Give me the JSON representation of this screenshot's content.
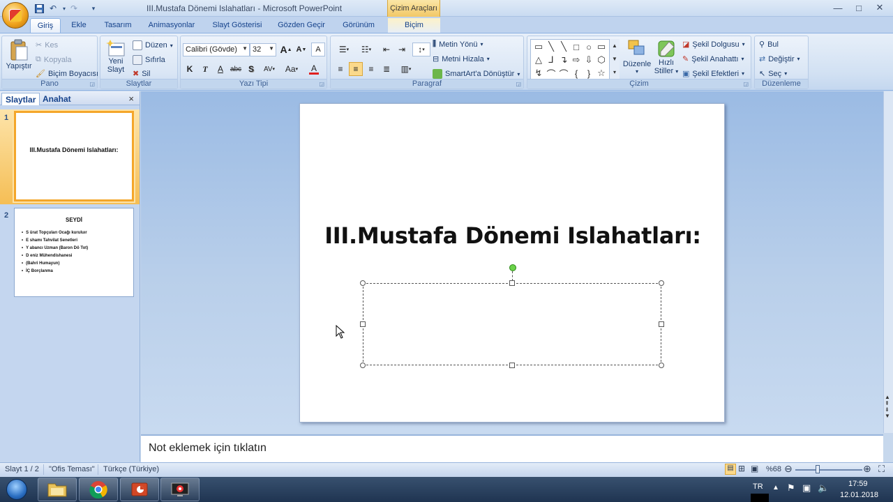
{
  "window": {
    "title": "III.Mustafa Dönemi Islahatları - Microsoft PowerPoint",
    "context_tab_group": "Çizim Araçları",
    "controls": {
      "minimize": "—",
      "maximize": "□",
      "close": "✕"
    }
  },
  "quick_access": {
    "save": "save-icon",
    "undo": "undo-icon",
    "redo": "redo-icon",
    "customize": "▾"
  },
  "tabs": [
    {
      "label": "Giriş",
      "active": true
    },
    {
      "label": "Ekle"
    },
    {
      "label": "Tasarım"
    },
    {
      "label": "Animasyonlar"
    },
    {
      "label": "Slayt Gösterisi"
    },
    {
      "label": "Gözden Geçir"
    },
    {
      "label": "Görünüm"
    },
    {
      "label": "Biçim",
      "context": true
    }
  ],
  "ribbon": {
    "pano": {
      "label": "Pano",
      "paste": "Yapıştır",
      "cut": "Kes",
      "copy": "Kopyala",
      "format_painter": "Biçim Boyacısı"
    },
    "slaytlar": {
      "label": "Slaytlar",
      "new_slide_line1": "Yeni",
      "new_slide_line2": "Slayt",
      "layout": "Düzen",
      "reset": "Sıfırla",
      "delete": "Sil"
    },
    "yazi_tipi": {
      "label": "Yazı Tipi",
      "font_name": "Calibri (Gövde)",
      "font_size": "32",
      "grow": "A",
      "shrink": "A",
      "clear": "A",
      "bold": "K",
      "italic": "T",
      "underline": "A",
      "strike": "abc",
      "shadow": "S",
      "spacing": "AV",
      "case": "Aa",
      "color": "A"
    },
    "paragraf": {
      "label": "Paragraf",
      "text_direction": "Metin Yönü",
      "align_text": "Metni Hizala",
      "smartart": "SmartArt'a Dönüştür"
    },
    "cizim": {
      "label": "Çizim",
      "arrange": "Düzenle",
      "quick_styles_line1": "Hızlı",
      "quick_styles_line2": "Stiller",
      "shape_fill": "Şekil Dolgusu",
      "shape_outline": "Şekil Anahattı",
      "shape_effects": "Şekil Efektleri",
      "shapes": [
        "▭",
        "╲",
        "╲",
        "□",
        "○",
        "▭",
        "△",
        "⅃",
        "↴",
        "⇨",
        "⇩",
        "⬡",
        "↯",
        "⌒",
        "⌒",
        "{",
        "}",
        "☆"
      ]
    },
    "duzenleme": {
      "label": "Düzenleme",
      "find": "Bul",
      "replace": "Değiştir",
      "select": "Seç"
    }
  },
  "left_pane": {
    "tab_slides": "Slaytlar",
    "tab_outline": "Anahat",
    "close": "×",
    "slides": [
      {
        "number": "1",
        "title": "III.Mustafa Dönemi Islahatları:"
      },
      {
        "number": "2",
        "title": "SEYDİ",
        "bullets": [
          "S ürat Topçuları Ocağı kuruluır",
          "E shamı Tahvilat Senetleri",
          "Y abancı Uzman (Baron Dö Tot)",
          "D eniz Mühendishanesi",
          "(Bahri Humayun)",
          "İÇ Borçlanma"
        ]
      }
    ]
  },
  "slide": {
    "title": "III.Mustafa Dönemi Islahatları:"
  },
  "notes": {
    "placeholder": "Not eklemek için tıklatın"
  },
  "status": {
    "slide_info": "Slayt 1 / 2",
    "theme": "\"Ofis Teması\"",
    "language": "Türkçe (Türkiye)",
    "zoom": "%68"
  },
  "taskbar": {
    "language": "TR",
    "time": "17:59",
    "date": "12.01.2018"
  },
  "colors": {
    "accent": "#f4a62a",
    "ribbon": "#dae6f5",
    "workspace": "#b9cfea"
  }
}
